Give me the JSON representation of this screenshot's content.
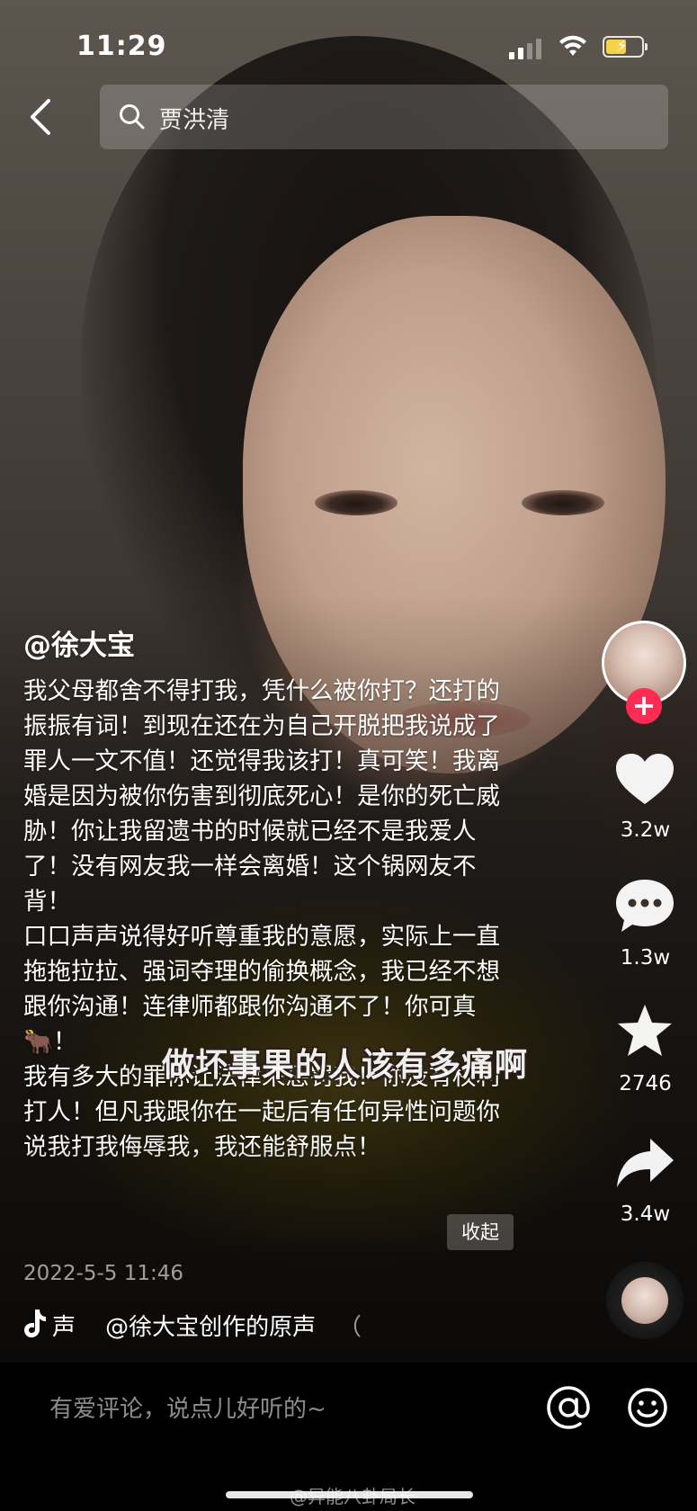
{
  "status_bar": {
    "time": "11:29"
  },
  "header": {
    "search_query": "贾洪清"
  },
  "post": {
    "author": "@徐大宝",
    "caption": "我父母都舍不得打我，凭什么被你打？还打的振振有词！到现在还在为自己开脱把我说成了罪人一文不值！还觉得我该打！真可笑！我离婚是因为被你伤害到彻底死心！是你的死亡威胁！你让我留遗书的时候就已经不是我爱人了！没有网友我一样会离婚！这个锅网友不背！\n口口声声说得好听尊重我的意愿，实际上一直拖拖拉拉、强词夺理的偷换概念，我已经不想跟你沟通！连律师都跟你沟通不了！你可真🐂！\n我有多大的罪你让法律来惩罚我！你没有权利打人！但凡我跟你在一起后有任何异性问题你说我打我侮辱我，我还能舒服点！",
    "subtitle_overlay": "做坏事果的人该有多痛啊",
    "collapse_label": "收起",
    "date": "2022-5-5 11:46",
    "music_prefix": "声",
    "music_text": "@徐大宝创作的原声",
    "music_suffix": "（"
  },
  "sidebar": {
    "likes": "3.2w",
    "comments": "1.3w",
    "favorites": "2746",
    "shares": "3.4w",
    "follow_symbol": "+"
  },
  "comment_bar": {
    "placeholder": "有爱评论，说点儿好听的~"
  },
  "watermark": "@异能八卦局长",
  "colors": {
    "follow_red": "#fe2c55",
    "battery_yellow": "#f6d24a"
  },
  "icons": [
    "back-arrow-icon",
    "search-icon",
    "heart-icon",
    "comment-icon",
    "star-icon",
    "share-icon",
    "music-note-icon",
    "at-icon",
    "emoji-icon",
    "wifi-icon",
    "battery-icon",
    "signal-icon"
  ]
}
